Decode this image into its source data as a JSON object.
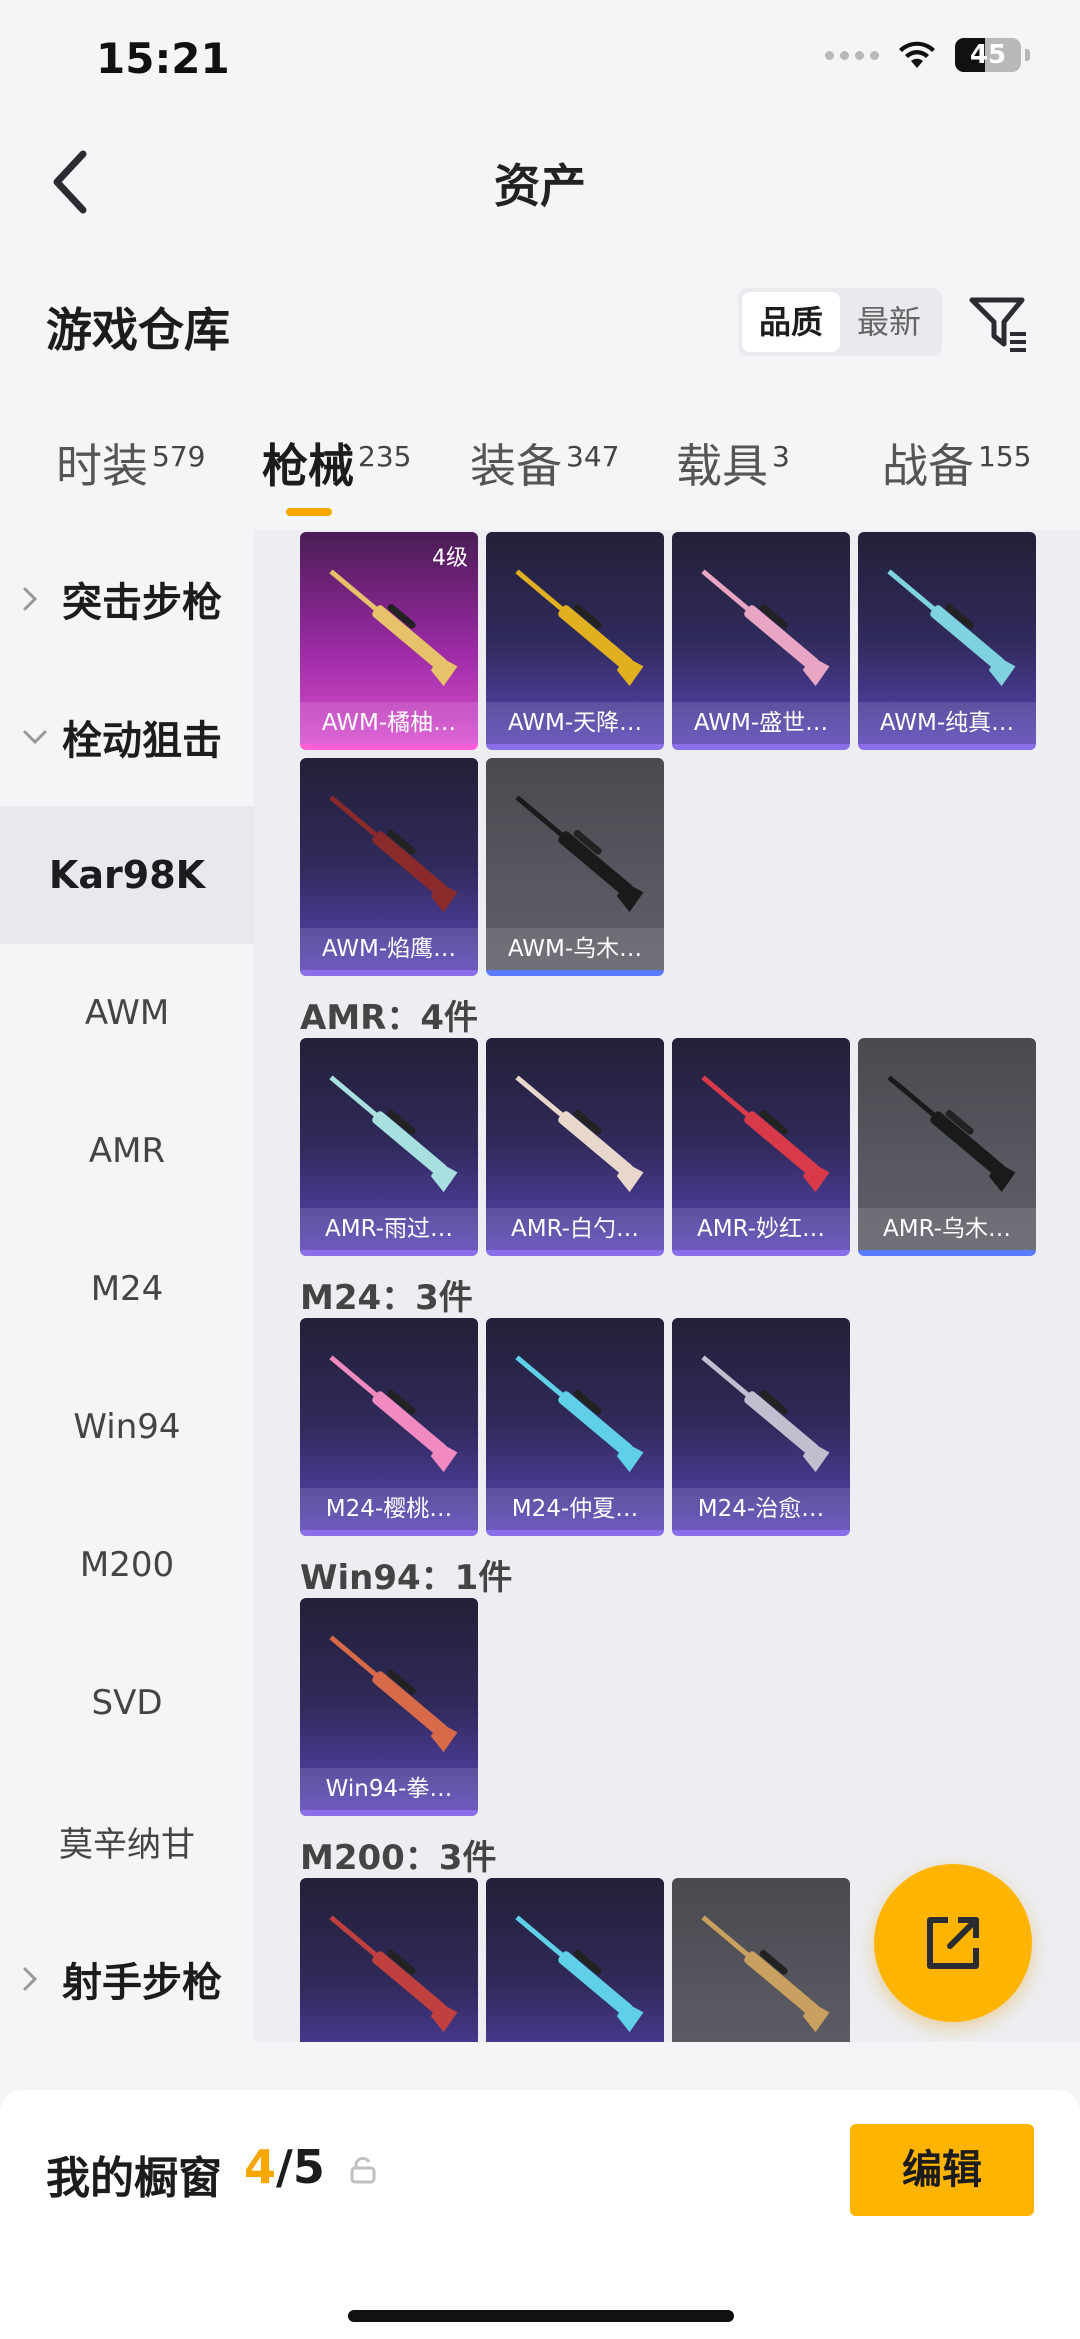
{
  "status": {
    "time": "15:21",
    "battery": "45",
    "battery_level": 0.45
  },
  "nav": {
    "title": "资产",
    "back_icon": "chevron-left-icon"
  },
  "warehouse": {
    "title": "游戏仓库",
    "sort_options": [
      {
        "label": "品质",
        "active": true
      },
      {
        "label": "最新",
        "active": false
      }
    ],
    "filter_icon": "filter-icon"
  },
  "tabs": [
    {
      "label": "时装",
      "count": "579",
      "active": false
    },
    {
      "label": "枪械",
      "count": "235",
      "active": true
    },
    {
      "label": "装备",
      "count": "347",
      "active": false
    },
    {
      "label": "载具",
      "count": "3",
      "active": false
    },
    {
      "label": "战备",
      "count": "155",
      "active": false
    }
  ],
  "sidebar": {
    "items": [
      {
        "label": "突击步枪",
        "type": "group",
        "expanded": false
      },
      {
        "label": "栓动狙击",
        "type": "group",
        "expanded": true
      },
      {
        "label": "Kar98K",
        "type": "sub",
        "selected": true
      },
      {
        "label": "AWM",
        "type": "sub"
      },
      {
        "label": "AMR",
        "type": "sub"
      },
      {
        "label": "M24",
        "type": "sub"
      },
      {
        "label": "Win94",
        "type": "sub"
      },
      {
        "label": "M200",
        "type": "sub"
      },
      {
        "label": "SVD",
        "type": "sub"
      },
      {
        "label": "莫辛纳甘",
        "type": "sub"
      },
      {
        "label": "射手步枪",
        "type": "group",
        "expanded": false
      }
    ]
  },
  "content": {
    "sections": [
      {
        "label": "",
        "items": [
          {
            "name": "AWM-橘柚…",
            "rarity": "pink",
            "level": "4级",
            "weapon_color": "#e8c26a"
          },
          {
            "name": "AWM-天降…",
            "rarity": "purple",
            "weapon_color": "#e0b020"
          },
          {
            "name": "AWM-盛世…",
            "rarity": "purple",
            "weapon_color": "#e9a6c4"
          },
          {
            "name": "AWM-纯真…",
            "rarity": "purple",
            "weapon_color": "#7fd3e0"
          },
          {
            "name": "AWM-焰鹰…",
            "rarity": "purple",
            "weapon_color": "#8a2a2a"
          },
          {
            "name": "AWM-乌木…",
            "rarity": "gray",
            "weapon_color": "#1a1a1a"
          }
        ]
      },
      {
        "label": "AMR：4件",
        "items": [
          {
            "name": "AMR-雨过…",
            "rarity": "purple",
            "weapon_color": "#a8e0e0"
          },
          {
            "name": "AMR-白勺…",
            "rarity": "purple",
            "weapon_color": "#e8d8cc"
          },
          {
            "name": "AMR-妙红…",
            "rarity": "purple",
            "weapon_color": "#d83a4a"
          },
          {
            "name": "AMR-乌木…",
            "rarity": "gray",
            "weapon_color": "#1a1a1a"
          }
        ]
      },
      {
        "label": "M24：3件",
        "items": [
          {
            "name": "M24-樱桃…",
            "rarity": "purple",
            "weapon_color": "#f08ac0"
          },
          {
            "name": "M24-仲夏…",
            "rarity": "purple",
            "weapon_color": "#5fd0e8"
          },
          {
            "name": "M24-治愈…",
            "rarity": "purple",
            "weapon_color": "#bfbfcf"
          }
        ]
      },
      {
        "label": "Win94：1件",
        "items": [
          {
            "name": "Win94-拳…",
            "rarity": "purple",
            "weapon_color": "#d86a4a"
          }
        ]
      },
      {
        "label": "M200：3件",
        "items": [
          {
            "name": "",
            "rarity": "purple",
            "weapon_color": "#c04040"
          },
          {
            "name": "",
            "rarity": "purple",
            "weapon_color": "#5fd0e8"
          },
          {
            "name": "",
            "rarity": "gray",
            "weapon_color": "#caa060"
          }
        ]
      }
    ]
  },
  "fab": {
    "icon": "share-external-icon"
  },
  "bottom": {
    "label": "我的橱窗",
    "current": "4",
    "total": "/5",
    "lock_icon": "unlock-icon",
    "edit_label": "编辑"
  },
  "colors": {
    "accent": "#ffb400",
    "purple_card": "#5a44b6",
    "pink_card": "#d84fcf",
    "gray_card": "#575860"
  }
}
